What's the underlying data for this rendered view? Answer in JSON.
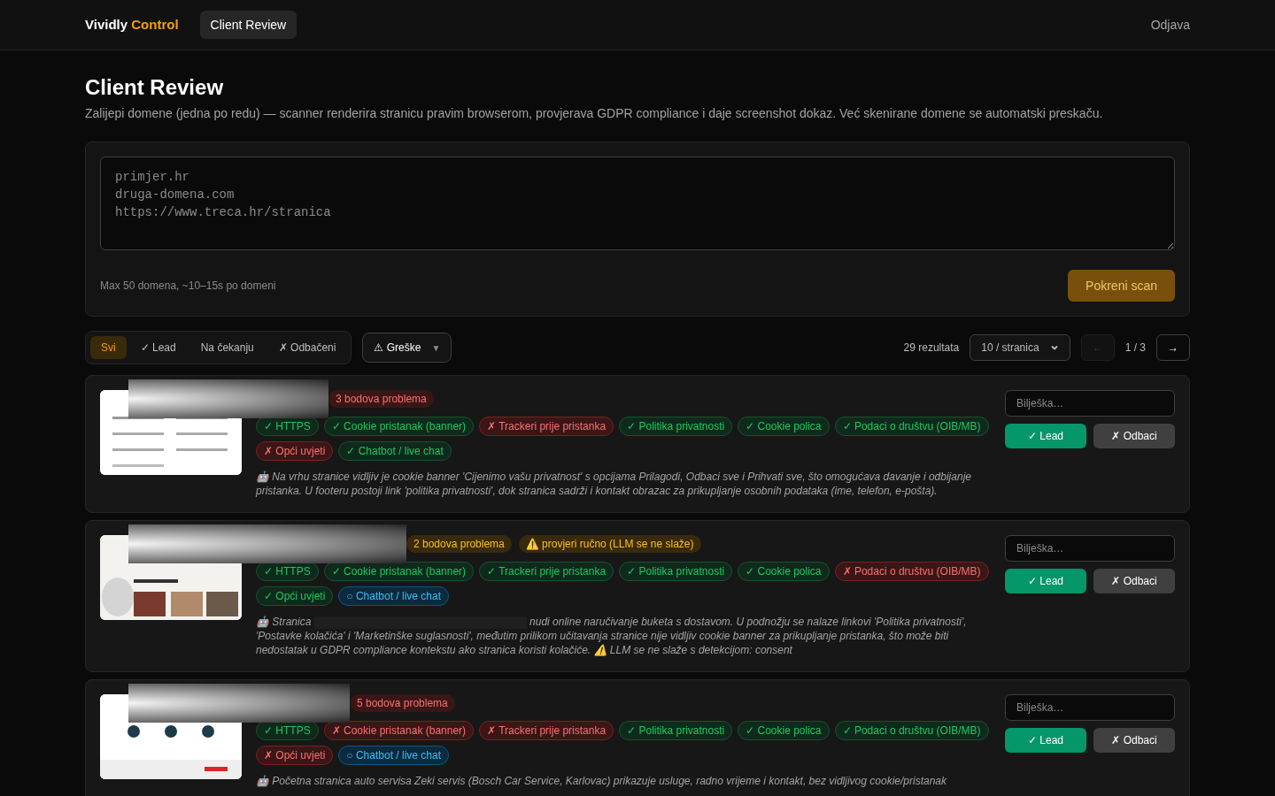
{
  "nav": {
    "brand_first": "Vividly",
    "brand_second": "Control",
    "tabs": [
      {
        "label": "Client Review",
        "selected": true
      }
    ],
    "logout": "Odjava"
  },
  "header": {
    "title": "Client Review",
    "subtitle": "Zalijepi domene (jedna po redu) — scanner renderira stranicu pravim browserom, provjerava GDPR compliance i daje screenshot dokaz. Već skenirane domene se automatski preskaču."
  },
  "scan_form": {
    "placeholder": "primjer.hr\ndruga-domena.com\nhttps://www.treca.hr/stranica",
    "hint": "Max 50 domena, ~10–15s po domeni",
    "button": "Pokreni scan"
  },
  "filters": {
    "tabs": [
      {
        "label": "Svi",
        "selected": true
      },
      {
        "label": "✓ Lead",
        "selected": false
      },
      {
        "label": "Na čekanju",
        "selected": false
      },
      {
        "label": "✗ Odbačeni",
        "selected": false
      }
    ],
    "dropdown": {
      "label": "⚠ Greške",
      "caret": "▼"
    },
    "count": "29 rezultata",
    "page_size": "10 / stranica",
    "prev": {
      "label": "←",
      "disabled": true
    },
    "page": "1 / 3",
    "next": {
      "label": "→",
      "disabled": false
    }
  },
  "results": [
    {
      "badges": [
        {
          "kind": "danger",
          "text": "3 bodova problema"
        }
      ],
      "checks": [
        {
          "kind": "pass",
          "label": "✓ HTTPS"
        },
        {
          "kind": "pass",
          "label": "✓ Cookie pristanak (banner)"
        },
        {
          "kind": "fail",
          "label": "✗ Trackeri prije pristanka"
        },
        {
          "kind": "pass",
          "label": "✓ Politika privatnosti"
        },
        {
          "kind": "pass",
          "label": "✓ Cookie polica"
        },
        {
          "kind": "pass",
          "label": "✓ Podaci o društvu (OIB/MB)"
        },
        {
          "kind": "fail",
          "label": "✗ Opći uvjeti"
        },
        {
          "kind": "pass",
          "label": "✓ Chatbot / live chat"
        }
      ],
      "summary_before": "🤖 Na vrhu stranice vidljiv je cookie banner 'Cijenimo vašu privatnost' s opcijama Prilagodi, Odbaci sve i Prihvati sve, što omogućava davanje i odbijanje pristanka. U footeru postoji link 'politika privatnosti', dok stranica sadrži i kontakt obrazac za prikupljanje osobnih podataka (ime, telefon, e-pošta).",
      "note_placeholder": "Bilješka…",
      "lead_button": "✓ Lead",
      "reject_button": "✗ Odbaci"
    },
    {
      "badges": [
        {
          "kind": "warning",
          "text": "2 bodova problema"
        },
        {
          "kind": "warning",
          "text": "⚠️ provjeri ručno (LLM se ne slaže)"
        }
      ],
      "checks": [
        {
          "kind": "pass",
          "label": "✓ HTTPS"
        },
        {
          "kind": "pass",
          "label": "✓ Cookie pristanak (banner)"
        },
        {
          "kind": "pass",
          "label": "✓ Trackeri prije pristanka"
        },
        {
          "kind": "pass",
          "label": "✓ Politika privatnosti"
        },
        {
          "kind": "pass",
          "label": "✓ Cookie polica"
        },
        {
          "kind": "fail",
          "label": "✗ Podaci o društvu (OIB/MB)"
        },
        {
          "kind": "pass",
          "label": "✓ Opći uvjeti"
        },
        {
          "kind": "unknown",
          "label": "○ Chatbot / live chat"
        }
      ],
      "summary_before": "🤖 Stranica",
      "summary_after": "nudi online naručivanje buketa s dostavom. U podnožju se nalaze linkovi 'Politika privatnosti', 'Postavke kolačića' i 'Marketinške suglasnosti', međutim prilikom učitavanja stranice nije vidljiv cookie banner za prikupljanje pristanka, što može biti nedostatak u GDPR compliance kontekstu ako stranica koristi kolačiće. ⚠️ LLM se ne slaže s detekcijom: consent",
      "note_placeholder": "Bilješka…",
      "lead_button": "✓ Lead",
      "reject_button": "✗ Odbaci"
    },
    {
      "badges": [
        {
          "kind": "danger",
          "text": "5 bodova problema"
        }
      ],
      "checks": [
        {
          "kind": "pass",
          "label": "✓ HTTPS"
        },
        {
          "kind": "fail",
          "label": "✗ Cookie pristanak (banner)"
        },
        {
          "kind": "fail",
          "label": "✗ Trackeri prije pristanka"
        },
        {
          "kind": "pass",
          "label": "✓ Politika privatnosti"
        },
        {
          "kind": "pass",
          "label": "✓ Cookie polica"
        },
        {
          "kind": "pass",
          "label": "✓ Podaci o društvu (OIB/MB)"
        },
        {
          "kind": "fail",
          "label": "✗ Opći uvjeti"
        },
        {
          "kind": "unknown",
          "label": "○ Chatbot / live chat"
        }
      ],
      "summary_before": "🤖 Početna stranica auto servisa Zeki servis (Bosch Car Service, Karlovac) prikazuje usluge, radno vrijeme i kontakt, bez vidljivog cookie/pristanak",
      "note_placeholder": "Bilješka…",
      "lead_button": "✓ Lead",
      "reject_button": "✗ Odbaci"
    }
  ]
}
